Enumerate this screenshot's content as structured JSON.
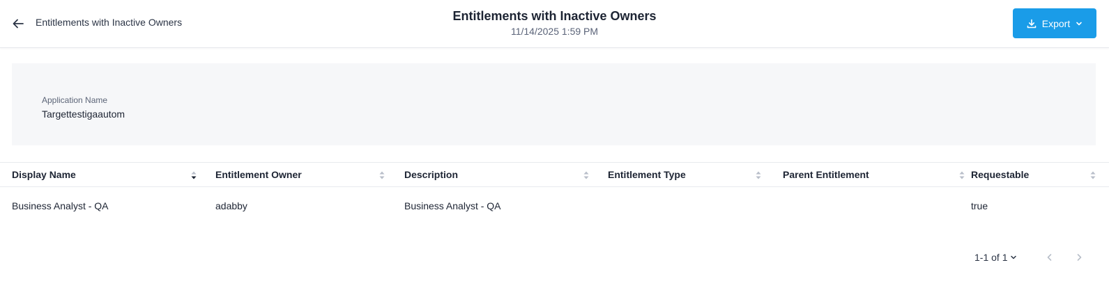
{
  "header": {
    "breadcrumb": "Entitlements with Inactive Owners",
    "title": "Entitlements with Inactive Owners",
    "timestamp": "11/14/2025 1:59 PM",
    "export_label": "Export"
  },
  "filters": {
    "application_label": "Application Name",
    "application_value": "Targettestigaautom"
  },
  "table": {
    "columns": [
      {
        "label": "Display Name",
        "sort": "descending"
      },
      {
        "label": "Entitlement Owner",
        "sort": "none"
      },
      {
        "label": "Description",
        "sort": "none"
      },
      {
        "label": "Entitlement Type",
        "sort": "none"
      },
      {
        "label": "Parent Entitlement",
        "sort": "none"
      },
      {
        "label": "Requestable",
        "sort": "none"
      }
    ],
    "rows": [
      {
        "display_name": "Business Analyst - QA",
        "entitlement_owner": "adabby",
        "description": "Business Analyst - QA",
        "entitlement_type": "",
        "parent_entitlement": "",
        "requestable": "true"
      }
    ]
  },
  "pagination": {
    "range_label": "1-1 of 1"
  },
  "colors": {
    "accent": "#1a9ce8",
    "panel_bg": "#f6f7f9",
    "text": "#1d2433",
    "muted": "#5a6378"
  },
  "icons": {
    "back": "arrow-left-icon",
    "export": "download-icon",
    "dropdown": "chevron-down-icon",
    "sort": "sort-icon",
    "prev": "chevron-left-icon",
    "next": "chevron-right-icon"
  }
}
